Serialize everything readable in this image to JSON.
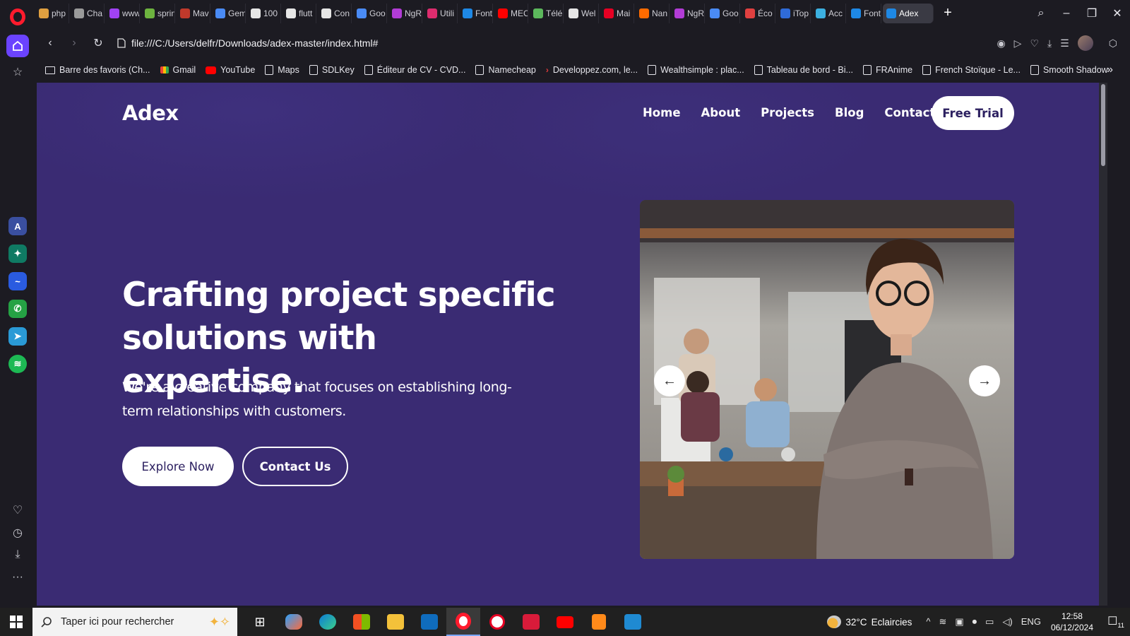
{
  "browser": {
    "tabs": [
      {
        "label": "php",
        "color": "#e0a040"
      },
      {
        "label": "Cha",
        "color": "#9a9a9a"
      },
      {
        "label": "www",
        "color": "#a142f4"
      },
      {
        "label": "sprin",
        "color": "#6db33f"
      },
      {
        "label": "Mav",
        "color": "#c0392b"
      },
      {
        "label": "Gem",
        "color": "#4a8bf5"
      },
      {
        "label": "100",
        "color": "#e6e6e6"
      },
      {
        "label": "flutt",
        "color": "#e6e6e6"
      },
      {
        "label": "Con",
        "color": "#e6e6e6"
      },
      {
        "label": "Goo",
        "color": "#4a8bf5"
      },
      {
        "label": "NgR",
        "color": "#b23cd6"
      },
      {
        "label": "Utili",
        "color": "#dd2c6e"
      },
      {
        "label": "Font",
        "color": "#1e88e5"
      },
      {
        "label": "MEC",
        "color": "#ff0000"
      },
      {
        "label": "Télé",
        "color": "#5cb85c"
      },
      {
        "label": "Wel",
        "color": "#e6e6e6"
      },
      {
        "label": "Mai",
        "color": "#e60023"
      },
      {
        "label": "Nan",
        "color": "#ff6b00"
      },
      {
        "label": "NgR",
        "color": "#b23cd6"
      },
      {
        "label": "Goo",
        "color": "#4a8bf5"
      },
      {
        "label": "Éco",
        "color": "#e04040"
      },
      {
        "label": "iTop",
        "color": "#2f6bd8"
      },
      {
        "label": "Acc",
        "color": "#3cb0e0"
      },
      {
        "label": "Font",
        "color": "#1e88e5"
      }
    ],
    "active_tab": {
      "label": "Adex",
      "color": "#1e88e5"
    },
    "new_tab": "+",
    "window_controls": {
      "search": "⌕",
      "minimize": "–",
      "restore": "❐",
      "close": "✕"
    },
    "address": "file:///C:/Users/delfr/Downloads/adex-master/index.html#",
    "bookmarks": [
      {
        "label": "Barre des favoris (Ch...",
        "kind": "folder"
      },
      {
        "label": "Gmail",
        "kind": "gmail"
      },
      {
        "label": "YouTube",
        "kind": "yt"
      },
      {
        "label": "Maps",
        "kind": "page"
      },
      {
        "label": "SDLKey",
        "kind": "page"
      },
      {
        "label": "Éditeur de CV - CVD...",
        "kind": "page"
      },
      {
        "label": "Namecheap",
        "kind": "page"
      },
      {
        "label": "Developpez.com, le...",
        "kind": "dev"
      },
      {
        "label": "Wealthsimple : plac...",
        "kind": "page"
      },
      {
        "label": "Tableau de bord - Bi...",
        "kind": "page"
      },
      {
        "label": "FRAnime",
        "kind": "page"
      },
      {
        "label": "French Stoïque - Le...",
        "kind": "page"
      },
      {
        "label": "Smooth Shadow",
        "kind": "page"
      }
    ],
    "bookmarks_more": "»"
  },
  "page": {
    "brand": "Adex",
    "nav": [
      "Home",
      "About",
      "Projects",
      "Blog",
      "Contact"
    ],
    "cta": "Free Trial",
    "headline_line1": "Crafting project specific",
    "headline_line2": "solutions with expertise.",
    "subtext_line1": "We're a creative company that focuses on establishing long-",
    "subtext_line2": "term relationships with customers.",
    "btn_explore": "Explore Now",
    "btn_contact": "Contact Us",
    "prev_arrow": "←",
    "next_arrow": "→",
    "colors": {
      "background": "#3a2b73",
      "button_text": "#2c2060"
    }
  },
  "taskbar": {
    "search_placeholder": "Taper ici pour rechercher",
    "weather_temp": "32°C",
    "weather_desc": "Eclaircies",
    "language": "ENG",
    "time": "12:58",
    "date": "06/12/2024",
    "notification_count": "11"
  }
}
